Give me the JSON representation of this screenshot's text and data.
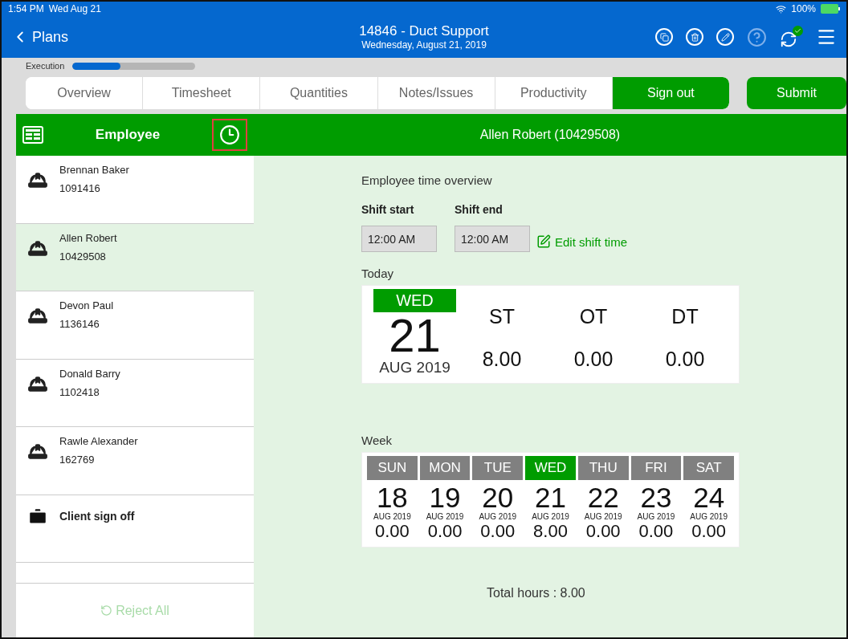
{
  "status_bar": {
    "time": "1:54 PM",
    "date": "Wed Aug 21",
    "battery": "100%"
  },
  "header": {
    "back": "Plans",
    "title": "14846 - Duct Support",
    "subtitle": "Wednesday, August 21, 2019",
    "sync_ok": true
  },
  "execution": {
    "label": "Execution",
    "level": 0.39
  },
  "tabs": [
    {
      "label": "Overview",
      "selected": false
    },
    {
      "label": "Timesheet",
      "selected": false
    },
    {
      "label": "Quantities",
      "selected": false
    },
    {
      "label": "Notes/Issues",
      "selected": false
    },
    {
      "label": "Productivity",
      "selected": false
    }
  ],
  "sign_out": "Sign out",
  "submit": "Submit",
  "sidebar": {
    "title": "Employee",
    "items": [
      {
        "kind": "employee",
        "name": "Brennan Baker",
        "id": "1091416",
        "selected": false
      },
      {
        "kind": "employee",
        "name": "Allen Robert",
        "id": "10429508",
        "selected": true
      },
      {
        "kind": "employee",
        "name": "Devon Paul",
        "id": "1136146",
        "selected": false
      },
      {
        "kind": "employee",
        "name": "Donald Barry",
        "id": "1102418",
        "selected": false
      },
      {
        "kind": "employee",
        "name": "Rawle Alexander",
        "id": "162769",
        "selected": false
      },
      {
        "kind": "client",
        "name": "Client sign off",
        "selected": false
      }
    ],
    "reject_all": {
      "label": "Reject All",
      "disabled": true
    }
  },
  "detail": {
    "title": "Allen Robert (10429508)",
    "heading": "Employee time overview",
    "shift_start": {
      "label": "Shift start",
      "value": "12:00 AM"
    },
    "shift_end": {
      "label": "Shift end",
      "value": "12:00 AM"
    },
    "edit_shift": "Edit  shift  time",
    "today": {
      "label": "Today",
      "weekday": "WED",
      "day": "21",
      "month": "AUG 2019",
      "columns": [
        {
          "label": "ST",
          "value": "8.00"
        },
        {
          "label": "OT",
          "value": "0.00"
        },
        {
          "label": "DT",
          "value": "0.00"
        }
      ]
    },
    "week": {
      "label": "Week",
      "days": [
        {
          "weekday": "SUN",
          "day": "18",
          "month": "AUG 2019",
          "hours": "0.00",
          "selected": false
        },
        {
          "weekday": "MON",
          "day": "19",
          "month": "AUG 2019",
          "hours": "0.00",
          "selected": false
        },
        {
          "weekday": "TUE",
          "day": "20",
          "month": "AUG 2019",
          "hours": "0.00",
          "selected": false
        },
        {
          "weekday": "WED",
          "day": "21",
          "month": "AUG 2019",
          "hours": "8.00",
          "selected": true
        },
        {
          "weekday": "THU",
          "day": "22",
          "month": "AUG 2019",
          "hours": "0.00",
          "selected": false
        },
        {
          "weekday": "FRI",
          "day": "23",
          "month": "AUG 2019",
          "hours": "0.00",
          "selected": false
        },
        {
          "weekday": "SAT",
          "day": "24",
          "month": "AUG 2019",
          "hours": "0.00",
          "selected": false
        }
      ]
    },
    "total": "Total hours : 8.00"
  }
}
